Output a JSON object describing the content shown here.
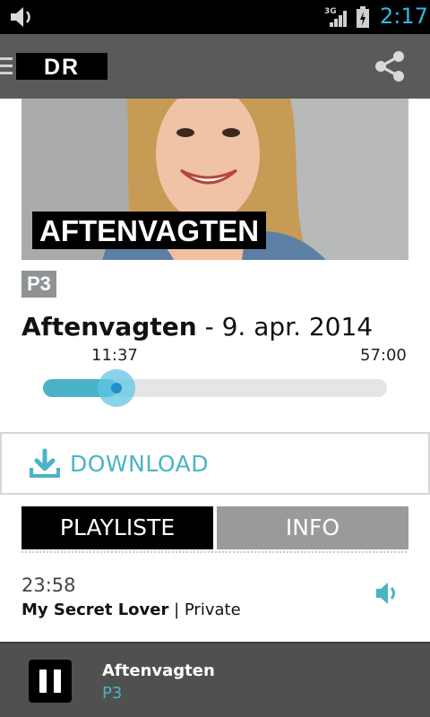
{
  "status_bar": {
    "network": "3G",
    "time": "2:17",
    "clock_color": "#35b5e5"
  },
  "app_bar": {
    "logo": "DR",
    "menu_icon": "hamburger-icon",
    "share_icon": "share-icon"
  },
  "program": {
    "image_caption": "AFTENVAGTEN",
    "channel": "P3",
    "title": "Aftenvagten",
    "separator": " - ",
    "date": "9. apr. 2014"
  },
  "player": {
    "current_time": "11:37",
    "total_time": "57:00",
    "progress": 0.204
  },
  "download": {
    "label": "DOWNLOAD",
    "icon": "download-icon"
  },
  "tabs": [
    {
      "label": "PLAYLISTE",
      "active": true
    },
    {
      "label": "INFO",
      "active": false
    }
  ],
  "playlist": [
    {
      "time": "23:58",
      "title": "My Secret Lover",
      "separator": " | ",
      "artist": "Private",
      "icon": "speaker-icon"
    }
  ],
  "mini_player": {
    "title": "Aftenvagten",
    "channel": "P3",
    "icon": "pause-icon"
  },
  "colors": {
    "accent": "#4ab4c6",
    "app_bar": "#5a5a5a",
    "tab_inactive": "#9a9a9a",
    "mini_player": "#505050"
  }
}
